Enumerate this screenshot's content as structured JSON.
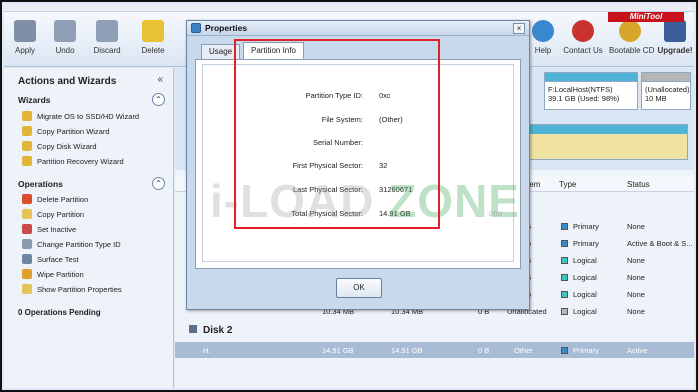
{
  "toolbar": {
    "buttons": [
      {
        "label": "Apply",
        "color": "#7e8fa6"
      },
      {
        "label": "Undo",
        "color": "#8fa0b6"
      },
      {
        "label": "Discard",
        "color": "#8fa0b6"
      },
      {
        "label": "Delete",
        "color": "#e8c232"
      }
    ],
    "right_buttons": [
      {
        "label": "Help",
        "color": "#3a86d1"
      },
      {
        "label": "Contact Us",
        "color": "#c9322e"
      },
      {
        "label": "Bootable CD",
        "color": "#d7a62a"
      },
      {
        "label": "Upgrade!",
        "color": "#3a5e9c"
      }
    ],
    "logo_text": "MiniTool"
  },
  "sidebar": {
    "title": "Actions and Wizards",
    "collapse_icon": "«",
    "wizards_title": "Wizards",
    "wizards": [
      "Migrate OS to SSD/HD Wizard",
      "Copy Partition Wizard",
      "Copy Disk Wizard",
      "Partition Recovery Wizard"
    ],
    "operations_title": "Operations",
    "operations": [
      "Delete Partition",
      "Copy Partition",
      "Set Inactive",
      "Change Partition Type ID",
      "Surface Test",
      "Wipe Partition",
      "Show Partition Properties"
    ],
    "pending": "0 Operations Pending"
  },
  "diskmap": {
    "partitions": [
      {
        "name": "F:LocalHost(NTFS)",
        "info": "39.1 GB (Used: 98%)"
      },
      {
        "name": "(Unallocated)",
        "info": "10 MB"
      }
    ]
  },
  "table": {
    "headers": {
      "system": "tem",
      "type": "Type",
      "status": "Status"
    },
    "rows": [
      {
        "c1": "5",
        "type": "Primary",
        "status": "None",
        "color": "#3a8bc9"
      },
      {
        "c1": "5",
        "type": "Primary",
        "status": "Active & Boot & S...",
        "color": "#3a8bc9"
      },
      {
        "c1": "5",
        "type": "Logical",
        "status": "None",
        "color": "#3fc4c4"
      },
      {
        "c1": "5",
        "type": "Logical",
        "status": "None",
        "color": "#3fc4c4"
      },
      {
        "c1": "5",
        "type": "Logical",
        "status": "None",
        "color": "#3fc4c4"
      },
      {
        "c1": "Unallocated",
        "type": "Logical",
        "status": "None",
        "color": "#b8b8b8",
        "c0": "10.34 MB",
        "c0b": "10.34 MB",
        "c0c": "0 B"
      }
    ],
    "disk2_label": "Disk 2",
    "selected_row": {
      "name": "H:",
      "capacity": "14.91 GB",
      "used": "14.91 GB",
      "unused": "0 B",
      "fs": "Other",
      "type": "Primary",
      "status": "Active",
      "color": "#3a8bc9"
    }
  },
  "dialog": {
    "title": "Properties",
    "close_label": "×",
    "tabs": [
      "Usage",
      "Partition Info"
    ],
    "fields": [
      {
        "label": "Partition Type ID:",
        "value": "0xc"
      },
      {
        "label": "File System:",
        "value": "(Other)"
      },
      {
        "label": "Serial Number:",
        "value": ""
      },
      {
        "label": "First Physical Sector:",
        "value": "32"
      },
      {
        "label": "Last Physical Sector:",
        "value": "31260671"
      },
      {
        "label": "Total Physical Sector:",
        "value": "14.91 GB"
      }
    ],
    "ok_label": "OK"
  },
  "watermark": {
    "part1": "i-LOAD",
    "part2": "ZONE",
    "sub": ".ORG"
  }
}
